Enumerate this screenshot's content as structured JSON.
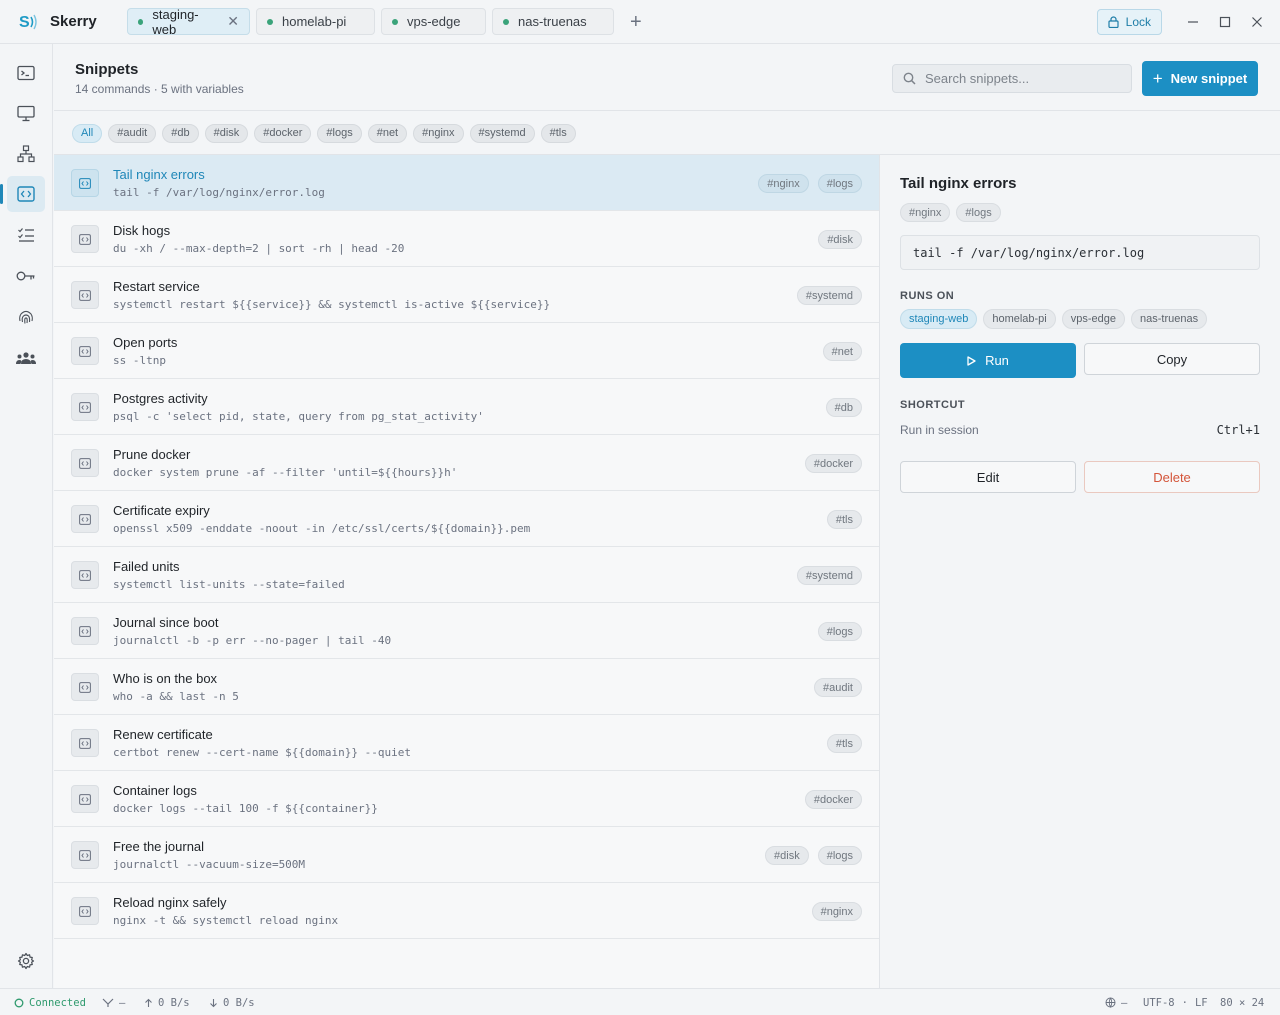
{
  "app": {
    "name": "Skerry"
  },
  "tabs": [
    {
      "label": "staging-web",
      "active": true
    },
    {
      "label": "homelab-pi",
      "active": false
    },
    {
      "label": "vps-edge",
      "active": false
    },
    {
      "label": "nas-truenas",
      "active": false
    }
  ],
  "titlebar": {
    "lock_label": "Lock"
  },
  "sidebar": {
    "items": [
      {
        "icon": "terminal-icon",
        "active": false
      },
      {
        "icon": "monitor-icon",
        "active": false
      },
      {
        "icon": "network-icon",
        "active": false
      },
      {
        "icon": "snippets-icon",
        "active": true
      },
      {
        "icon": "checklist-icon",
        "active": false
      },
      {
        "icon": "key-icon",
        "active": false
      },
      {
        "icon": "fingerprint-icon",
        "active": false
      },
      {
        "icon": "team-icon",
        "active": false
      }
    ],
    "bottom_icon": "gear-icon"
  },
  "header": {
    "title": "Snippets",
    "subtitle": "14 commands · 5 with variables",
    "search_placeholder": "Search snippets...",
    "new_button": "New snippet"
  },
  "filters": [
    "All",
    "#audit",
    "#db",
    "#disk",
    "#docker",
    "#logs",
    "#net",
    "#nginx",
    "#systemd",
    "#tls"
  ],
  "active_filter": "All",
  "snippets": [
    {
      "title": "Tail nginx errors",
      "command": "tail -f /var/log/nginx/error.log",
      "tags": [
        "#nginx",
        "#logs"
      ],
      "selected": true
    },
    {
      "title": "Disk hogs",
      "command": "du -xh / --max-depth=2 | sort -rh | head -20",
      "tags": [
        "#disk"
      ]
    },
    {
      "title": "Restart service",
      "command": "systemctl restart ${{service}} && systemctl is-active ${{service}}",
      "tags": [
        "#systemd"
      ]
    },
    {
      "title": "Open ports",
      "command": "ss -ltnp",
      "tags": [
        "#net"
      ]
    },
    {
      "title": "Postgres activity",
      "command": "psql -c 'select pid, state, query from pg_stat_activity'",
      "tags": [
        "#db"
      ]
    },
    {
      "title": "Prune docker",
      "command": "docker system prune -af --filter 'until=${{hours}}h'",
      "tags": [
        "#docker"
      ]
    },
    {
      "title": "Certificate expiry",
      "command": "openssl x509 -enddate -noout -in /etc/ssl/certs/${{domain}}.pem",
      "tags": [
        "#tls"
      ]
    },
    {
      "title": "Failed units",
      "command": "systemctl list-units --state=failed",
      "tags": [
        "#systemd"
      ]
    },
    {
      "title": "Journal since boot",
      "command": "journalctl -b -p err --no-pager | tail -40",
      "tags": [
        "#logs"
      ]
    },
    {
      "title": "Who is on the box",
      "command": "who -a && last -n 5",
      "tags": [
        "#audit"
      ]
    },
    {
      "title": "Renew certificate",
      "command": "certbot renew --cert-name ${{domain}} --quiet",
      "tags": [
        "#tls"
      ]
    },
    {
      "title": "Container logs",
      "command": "docker logs --tail 100 -f ${{container}}",
      "tags": [
        "#docker"
      ]
    },
    {
      "title": "Free the journal",
      "command": "journalctl --vacuum-size=500M",
      "tags": [
        "#disk",
        "#logs"
      ]
    },
    {
      "title": "Reload nginx safely",
      "command": "nginx -t && systemctl reload nginx",
      "tags": [
        "#nginx"
      ]
    }
  ],
  "detail": {
    "title": "Tail nginx errors",
    "tags": [
      "#nginx",
      "#logs"
    ],
    "command": "tail -f /var/log/nginx/error.log",
    "runs_on_label": "RUNS ON",
    "hosts": [
      {
        "label": "staging-web",
        "active": true
      },
      {
        "label": "homelab-pi",
        "active": false
      },
      {
        "label": "vps-edge",
        "active": false
      },
      {
        "label": "nas-truenas",
        "active": false
      }
    ],
    "run_label": "Run",
    "copy_label": "Copy",
    "shortcut_label": "SHORTCUT",
    "shortcut_desc": "Run in session",
    "shortcut_keys": "Ctrl+1",
    "edit_label": "Edit",
    "delete_label": "Delete"
  },
  "status": {
    "connection": "Connected",
    "branch": "—",
    "upload": "0 B/s",
    "download": "0 B/s",
    "globe": "—",
    "encoding": "UTF-8",
    "eol": "LF",
    "size": "80 × 24"
  },
  "colors": {
    "accent": "#1c8fc4",
    "connected": "#2f9a6e",
    "danger": "#d4553a"
  }
}
